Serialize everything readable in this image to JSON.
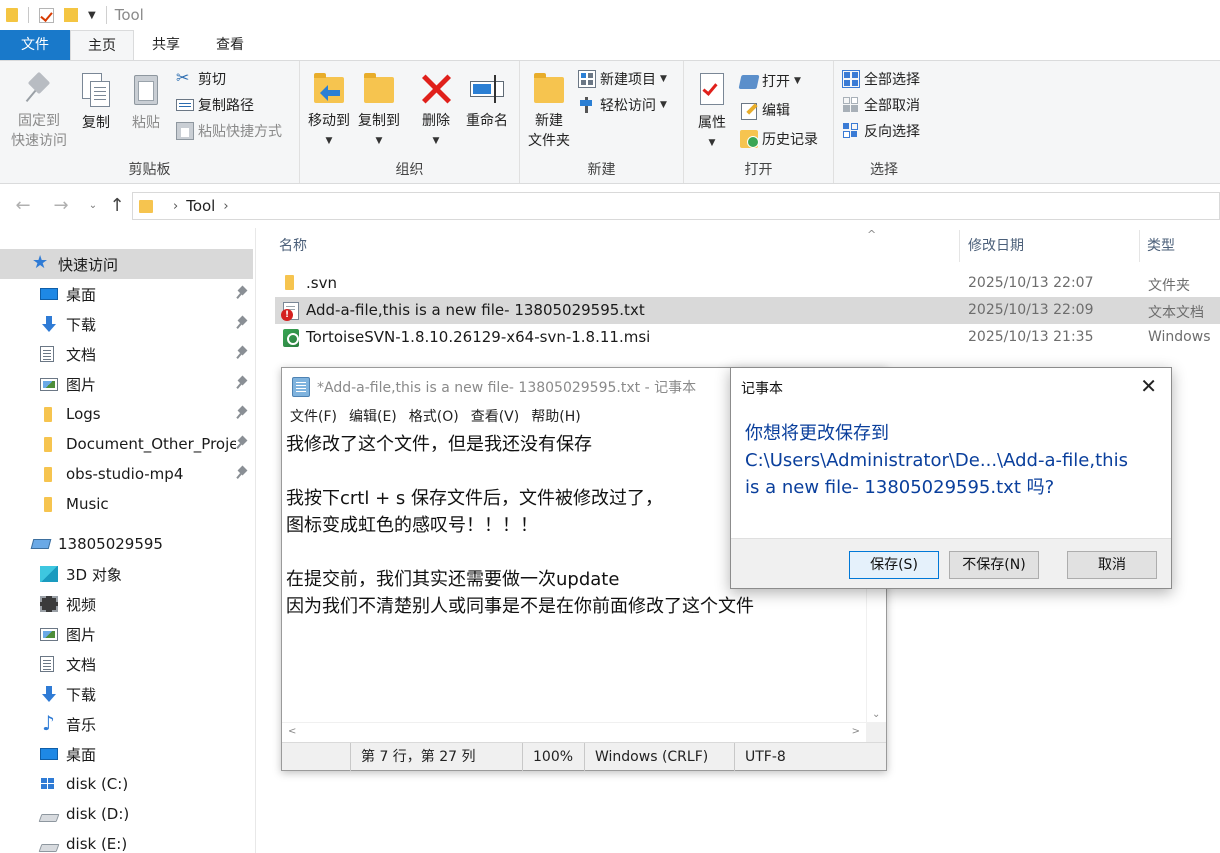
{
  "titlebar": {
    "title": "Tool"
  },
  "tabs": [
    {
      "label": "文件"
    },
    {
      "label": "主页"
    },
    {
      "label": "共享"
    },
    {
      "label": "查看"
    }
  ],
  "ribbon": {
    "clipboard": {
      "label": "剪贴板",
      "pin": "固定到\n快速访问",
      "copy": "复制",
      "paste": "粘贴",
      "cut": "剪切",
      "copy_path": "复制路径",
      "paste_shortcut": "粘贴快捷方式"
    },
    "organize": {
      "label": "组织",
      "move_to": "移动到",
      "copy_to": "复制到",
      "delete": "删除",
      "rename": "重命名"
    },
    "new": {
      "label": "新建",
      "new_folder": "新建\n文件夹",
      "new_item": "新建项目",
      "easy_access": "轻松访问"
    },
    "open": {
      "label": "打开",
      "properties": "属性",
      "open": "打开",
      "edit": "编辑",
      "history": "历史记录"
    },
    "select": {
      "label": "选择",
      "select_all": "全部选择",
      "select_none": "全部取消",
      "invert": "反向选择"
    }
  },
  "address": {
    "crumb": "Tool"
  },
  "navpane": {
    "items": [
      {
        "label": "快速访问",
        "icon": "star-icon"
      },
      {
        "label": "桌面",
        "icon": "desktop-icon"
      },
      {
        "label": "下载",
        "icon": "download-icon"
      },
      {
        "label": "文档",
        "icon": "document-icon"
      },
      {
        "label": "图片",
        "icon": "picture-icon"
      },
      {
        "label": "Logs",
        "icon": "folder-icon"
      },
      {
        "label": "Document_Other_Proje",
        "icon": "folder-icon"
      },
      {
        "label": "obs-studio-mp4",
        "icon": "folder-icon"
      },
      {
        "label": "Music",
        "icon": "folder-icon"
      },
      {
        "label": "13805029595",
        "icon": "computer-icon"
      },
      {
        "label": "3D 对象",
        "icon": "3d-objects-icon"
      },
      {
        "label": "视频",
        "icon": "video-icon"
      },
      {
        "label": "图片",
        "icon": "picture-icon"
      },
      {
        "label": "文档",
        "icon": "document-icon"
      },
      {
        "label": "下载",
        "icon": "download-icon"
      },
      {
        "label": "音乐",
        "icon": "music-icon"
      },
      {
        "label": "桌面",
        "icon": "desktop-icon"
      },
      {
        "label": "disk (C:)",
        "icon": "windows-drive-icon"
      },
      {
        "label": "disk (D:)",
        "icon": "drive-icon"
      },
      {
        "label": "disk (E:)",
        "icon": "drive-icon"
      }
    ]
  },
  "filelist": {
    "columns": {
      "name": "名称",
      "date": "修改日期",
      "type": "类型"
    },
    "rows": [
      {
        "name": ".svn",
        "date": "2025/10/13 22:07",
        "type": "文件夹"
      },
      {
        "name": "Add-a-file,this is a new file- 13805029595.txt",
        "date": "2025/10/13 22:09",
        "type": "文本文档"
      },
      {
        "name": "TortoiseSVN-1.8.10.26129-x64-svn-1.8.11.msi",
        "date": "2025/10/13 21:35",
        "type": "Windows"
      }
    ]
  },
  "notepad": {
    "title": "*Add-a-file,this is a new file- 13805029595.txt - 记事本",
    "menu": [
      "文件(F)",
      "编辑(E)",
      "格式(O)",
      "查看(V)",
      "帮助(H)"
    ],
    "lines": [
      "我修改了这个文件，但是我还没有保存",
      "",
      "我按下crtl + s 保存文件后，文件被修改过了，",
      "图标变成虹色的感叹号！！！！",
      "",
      "在提交前，我们其实还需要做一次update",
      "因为我们不清楚别人或同事是不是在你前面修改了这个文件"
    ],
    "status": {
      "position": "第 7 行，第 27 列",
      "zoom": "100%",
      "eol": "Windows (CRLF)",
      "encoding": "UTF-8"
    }
  },
  "dialog": {
    "title": "记事本",
    "message": [
      "你想将更改保存到",
      "C:\\Users\\Administrator\\De...\\Add-a-file,this",
      "is a new file- 13805029595.txt 吗?"
    ],
    "buttons": {
      "save": "保存(S)",
      "dont_save": "不保存(N)",
      "cancel": "取消"
    }
  }
}
